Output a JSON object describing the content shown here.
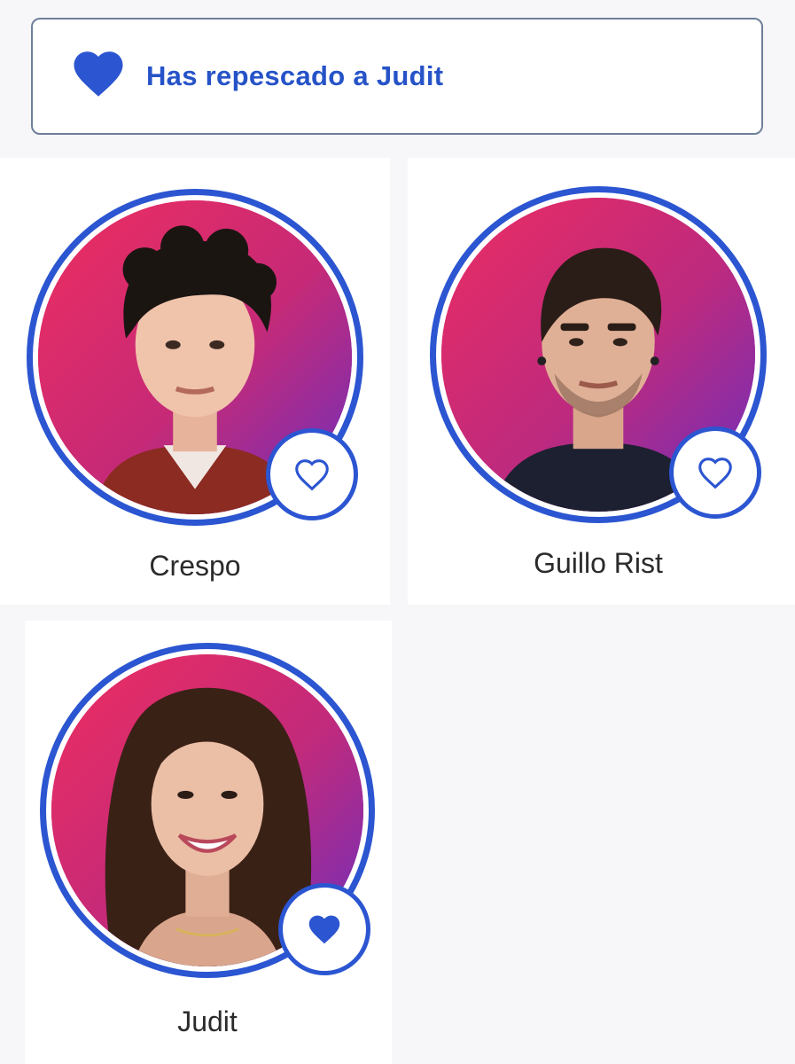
{
  "banner": {
    "icon": "heart-filled-icon",
    "text": "Has repescado a Judit"
  },
  "colors": {
    "accent": "#2b55d1",
    "banner_text": "#2653c8",
    "background": "#f7f7f9",
    "avatar_gradient": [
      "#e9336a",
      "#9a35b3",
      "#6b2ebd"
    ]
  },
  "contestants": [
    {
      "name": "Crespo",
      "favorited": false,
      "heart_icon": "heart-outline-icon"
    },
    {
      "name": "Guillo Rist",
      "favorited": false,
      "heart_icon": "heart-outline-icon"
    },
    {
      "name": "Judit",
      "favorited": true,
      "heart_icon": "heart-filled-icon"
    }
  ]
}
